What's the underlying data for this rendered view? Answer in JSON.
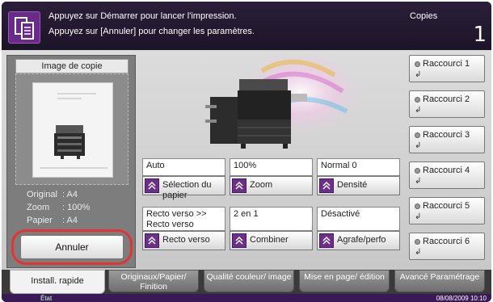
{
  "message": {
    "line1": "Appuyez sur Démarrer pour lancer l'impression.",
    "line2": "Appuyez sur [Annuler] pour changer les paramètres.",
    "icon": "copy-document-icon"
  },
  "copies": {
    "label": "Copies",
    "value": "1"
  },
  "preview": {
    "title": "Image de copie",
    "original": {
      "label": "Original",
      "value": ": A4"
    },
    "zoom": {
      "label": "Zoom",
      "value": ": 100%"
    },
    "papier": {
      "label": "Papier",
      "value": ": A4"
    }
  },
  "annuler_label": "Annuler",
  "functions": [
    {
      "value": "Auto",
      "label": "Sélection du papier"
    },
    {
      "value": "100%",
      "label": "Zoom"
    },
    {
      "value": "Normal 0",
      "label": "Densité"
    },
    {
      "value": "Recto verso >> Recto verso",
      "label": "Recto verso"
    },
    {
      "value": "2 en 1",
      "label": "Combiner"
    },
    {
      "value": "Désactivé",
      "label": "Agrafe/perfo"
    }
  ],
  "shortcuts": [
    {
      "label": "Raccourci 1"
    },
    {
      "label": "Raccourci 2"
    },
    {
      "label": "Raccourci 3"
    },
    {
      "label": "Raccourci 4"
    },
    {
      "label": "Raccourci 5"
    },
    {
      "label": "Raccourci 6"
    }
  ],
  "tabs": [
    {
      "label": "Install. rapide",
      "active": true
    },
    {
      "label": "Originaux/Papier/ Finition"
    },
    {
      "label": "Qualité couleur/ image"
    },
    {
      "label": "Mise en page/ édition"
    },
    {
      "label": "Avancé Paramétrage"
    }
  ],
  "status": {
    "label": "État",
    "datetime": "08/08/2009   10:10"
  },
  "colors": {
    "accent": "#6e2f8a",
    "highlight": "#e53333"
  }
}
